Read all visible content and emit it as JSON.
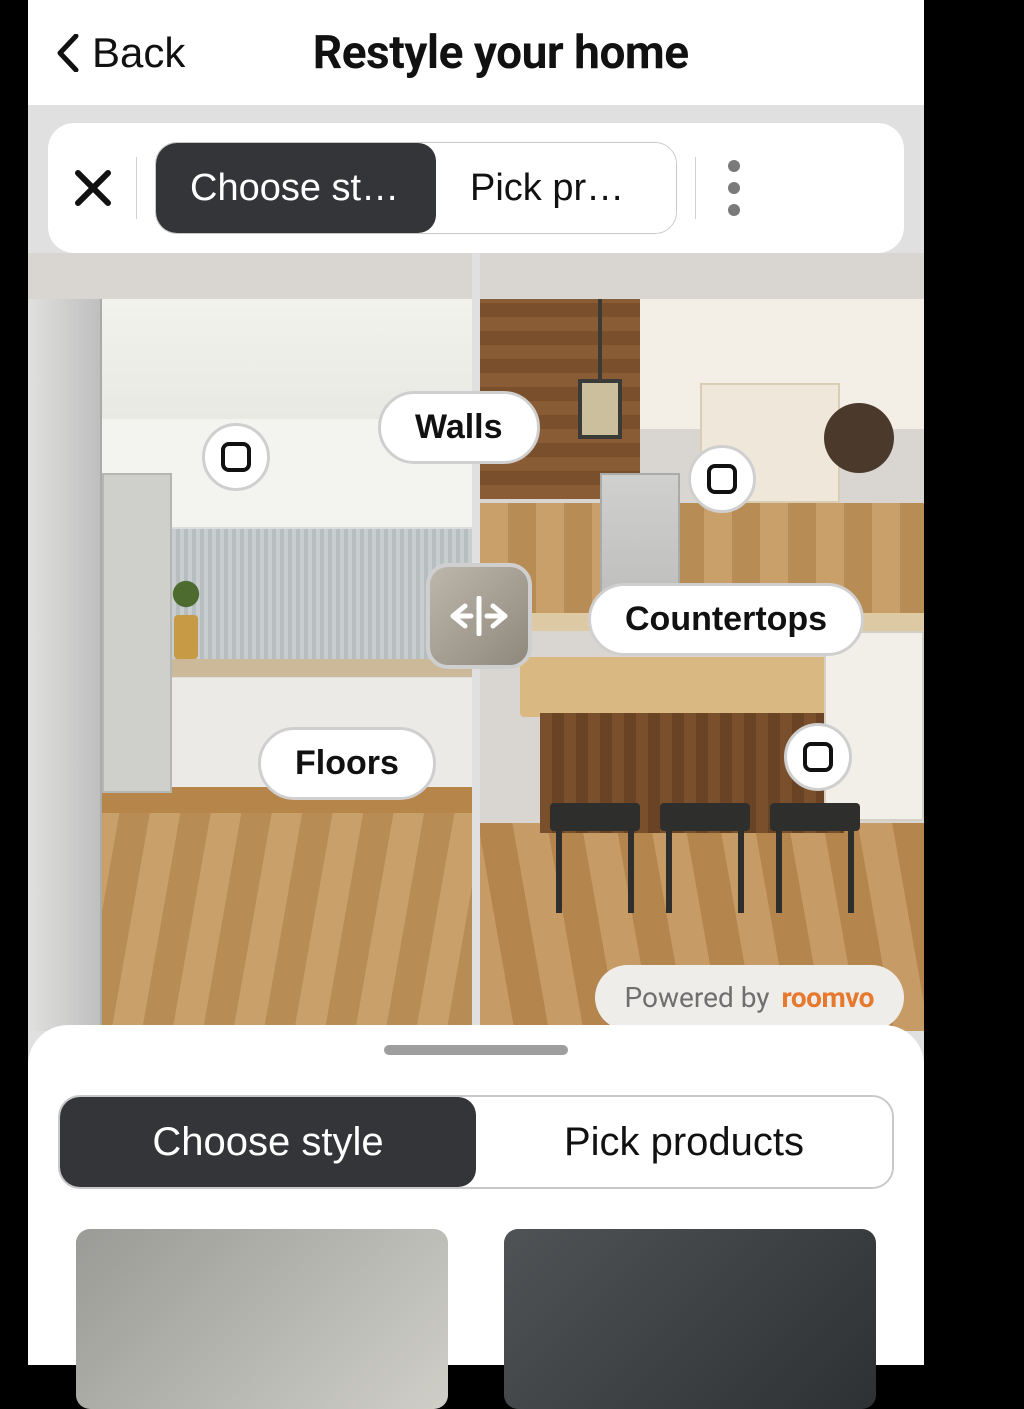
{
  "header": {
    "back_label": "Back",
    "title": "Restyle your home"
  },
  "top_toolbar": {
    "close_icon": "close",
    "segments": [
      {
        "label": "Choose style",
        "active": true
      },
      {
        "label": "Pick produ...",
        "active": false
      }
    ],
    "more_icon": "more-vertical"
  },
  "compare": {
    "pills": {
      "walls": "Walls",
      "countertops": "Countertops",
      "floors": "Floors"
    },
    "slider_icon": "compare-horizontal"
  },
  "powered_by": {
    "label": "Powered by",
    "brand": "roomvo"
  },
  "bottom_sheet": {
    "segments": [
      {
        "label": "Choose style",
        "active": true
      },
      {
        "label": "Pick products",
        "active": false
      }
    ]
  }
}
